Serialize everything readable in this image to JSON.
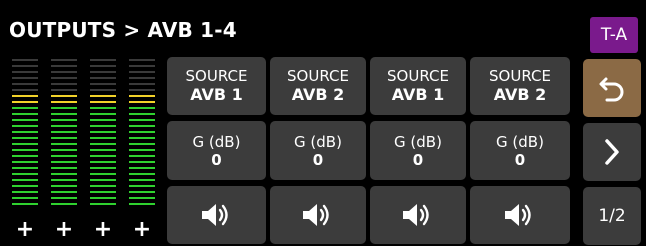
{
  "header": {
    "title": "OUTPUTS > AVB 1-4",
    "mode_button": "T-A",
    "mode_button_color": "#7a1a8c"
  },
  "meters": {
    "count": 4,
    "plus_labels": [
      "+",
      "+",
      "+",
      "+"
    ],
    "colors": {
      "off": "#3a3a3a",
      "yellow": "#f2d22a",
      "green": "#2fd12f"
    }
  },
  "channels": [
    {
      "source_label": "SOURCE",
      "source_value": "AVB 1",
      "gain_label": "G (dB)",
      "gain_value": "0",
      "mute_icon": "speaker-icon"
    },
    {
      "source_label": "SOURCE",
      "source_value": "AVB 2",
      "gain_label": "G (dB)",
      "gain_value": "0",
      "mute_icon": "speaker-icon"
    },
    {
      "source_label": "SOURCE",
      "source_value": "AVB 1",
      "gain_label": "G (dB)",
      "gain_value": "0",
      "mute_icon": "speaker-icon"
    },
    {
      "source_label": "SOURCE",
      "source_value": "AVB 2",
      "gain_label": "G (dB)",
      "gain_value": "0",
      "mute_icon": "speaker-icon"
    }
  ],
  "side": {
    "back_icon": "undo-arrow-icon",
    "back_color": "#8b6a45",
    "next_icon": "chevron-right-icon",
    "page": "1/2"
  }
}
